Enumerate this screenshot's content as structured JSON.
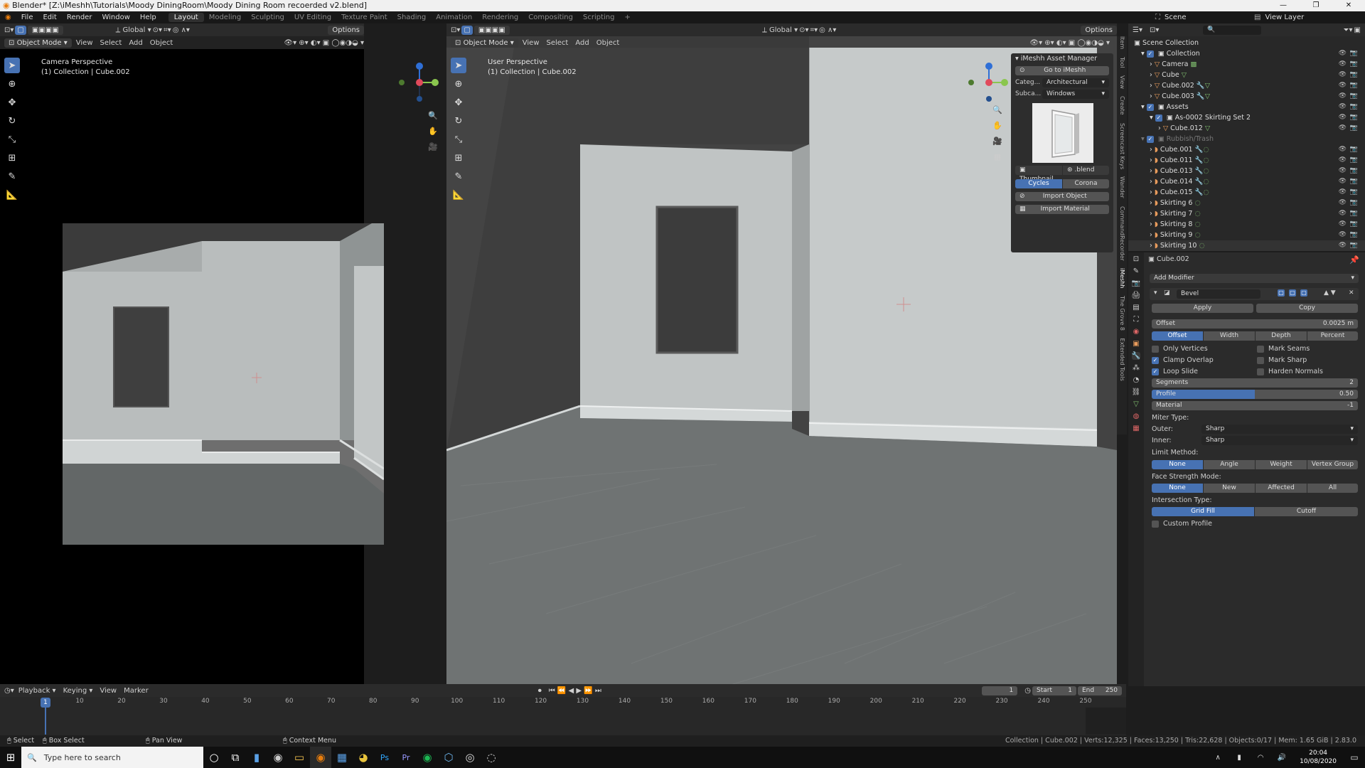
{
  "window": {
    "title": "Blender* [Z:\\iMeshh\\Tutorials\\Moody DiningRoom\\Moody Dining Room recoerded v2.blend]",
    "controls": [
      "—",
      "❐",
      "✕"
    ]
  },
  "menubar": {
    "menus": [
      "File",
      "Edit",
      "Render",
      "Window",
      "Help"
    ],
    "workspaces": [
      "Layout",
      "Modeling",
      "Sculpting",
      "UV Editing",
      "Texture Paint",
      "Shading",
      "Animation",
      "Rendering",
      "Compositing",
      "Scripting",
      "+"
    ],
    "active_workspace": "Layout",
    "scene": "Scene",
    "view_layer": "View Layer"
  },
  "left_viewport": {
    "mode": "Object Mode",
    "menus": [
      "View",
      "Select",
      "Add",
      "Object"
    ],
    "transform": "Global",
    "options": "Options",
    "perspective": "Camera Perspective",
    "collection": "(1) Collection | Cube.002"
  },
  "main_viewport": {
    "mode": "Object Mode",
    "menus": [
      "View",
      "Select",
      "Add",
      "Object"
    ],
    "transform": "Global",
    "options": "Options",
    "perspective": "User Perspective",
    "collection": "(1) Collection | Cube.002"
  },
  "asset_manager": {
    "title": "iMeshh Asset Manager",
    "goto_button": "Go to iMeshh",
    "category_label": "Categ...",
    "category_value": "Architectural",
    "subcategory_label": "Subca...",
    "subcategory_value": "Windows",
    "thumbnail_tab": "Thumbnail",
    "blend_tab": ".blend",
    "engine_cycles": "Cycles",
    "engine_corona": "Corona",
    "import_object": "Import Object",
    "import_material": "Import Material"
  },
  "side_tabs": [
    "Item",
    "Tool",
    "View",
    "Create",
    "Screencast Keys",
    "Wander",
    "CommandRecorder",
    "iMeshh",
    "The Grove 8",
    "Extended Tools"
  ],
  "outliner": {
    "root": "Scene Collection",
    "rows": [
      {
        "label": "Collection",
        "indent": 1
      },
      {
        "label": "Camera",
        "indent": 2
      },
      {
        "label": "Cube",
        "indent": 2
      },
      {
        "label": "Cube.002",
        "indent": 2
      },
      {
        "label": "Cube.003",
        "indent": 2
      },
      {
        "label": "Assets",
        "indent": 1
      },
      {
        "label": "As-0002 Skirting Set 2",
        "indent": 2
      },
      {
        "label": "Cube.012",
        "indent": 3
      },
      {
        "label": "Rubbish/Trash",
        "indent": 1
      },
      {
        "label": "Cube.001",
        "indent": 2
      },
      {
        "label": "Cube.011",
        "indent": 2
      },
      {
        "label": "Cube.013",
        "indent": 2
      },
      {
        "label": "Cube.014",
        "indent": 2
      },
      {
        "label": "Cube.015",
        "indent": 2
      },
      {
        "label": "Skirting 6",
        "indent": 2
      },
      {
        "label": "Skirting 7",
        "indent": 2
      },
      {
        "label": "Skirting 8",
        "indent": 2
      },
      {
        "label": "Skirting 9",
        "indent": 2
      },
      {
        "label": "Skirting 10",
        "indent": 2
      }
    ]
  },
  "properties": {
    "object": "Cube.002",
    "add_modifier": "Add Modifier",
    "modifier_name": "Bevel",
    "apply": "Apply",
    "copy": "Copy",
    "offset_label": "Offset",
    "offset_value": "0.0025 m",
    "width_types": [
      "Offset",
      "Width",
      "Depth",
      "Percent"
    ],
    "only_vertices": "Only Vertices",
    "clamp_overlap": "Clamp Overlap",
    "loop_slide": "Loop Slide",
    "mark_seams": "Mark Seams",
    "mark_sharp": "Mark Sharp",
    "harden_normals": "Harden Normals",
    "segments_label": "Segments",
    "segments_value": "2",
    "profile_label": "Profile",
    "profile_value": "0.50",
    "profile_fraction": 0.5,
    "material_label": "Material",
    "material_value": "-1",
    "miter_type": "Miter Type:",
    "outer_label": "Outer:",
    "outer_value": "Sharp",
    "inner_label": "Inner:",
    "inner_value": "Sharp",
    "limit_method": "Limit Method:",
    "limit_options": [
      "None",
      "Angle",
      "Weight",
      "Vertex Group"
    ],
    "face_strength": "Face Strength Mode:",
    "face_strength_options": [
      "None",
      "New",
      "Affected",
      "All"
    ],
    "intersection_type": "Intersection Type:",
    "intersection_options": [
      "Grid Fill",
      "Cutoff"
    ],
    "custom_profile": "Custom Profile"
  },
  "timeline": {
    "menus": [
      "Playback",
      "Keying",
      "View",
      "Marker"
    ],
    "current_frame": "1",
    "start_label": "Start",
    "start": "1",
    "end_label": "End",
    "end": "250",
    "ticks": [
      "1",
      "10",
      "20",
      "30",
      "40",
      "50",
      "60",
      "70",
      "80",
      "90",
      "100",
      "110",
      "120",
      "130",
      "140",
      "150",
      "160",
      "170",
      "180",
      "190",
      "200",
      "210",
      "220",
      "230",
      "240",
      "250"
    ]
  },
  "statusbar": {
    "select": "Select",
    "box_select": "Box Select",
    "pan_view": "Pan View",
    "context_menu": "Context Menu",
    "stats": "Collection | Cube.002 | Verts:12,325 | Faces:13,250 | Tris:22,628 | Objects:0/17 | Mem: 1.65 GiB | 2.83.0"
  },
  "taskbar": {
    "search_placeholder": "Type here to search",
    "time": "20:04",
    "date": "10/08/2020"
  },
  "colors": {
    "accent": "#4772b3",
    "header": "#2b2b2b",
    "panel": "#303030",
    "viewport_bg": "#3d3d3d"
  }
}
